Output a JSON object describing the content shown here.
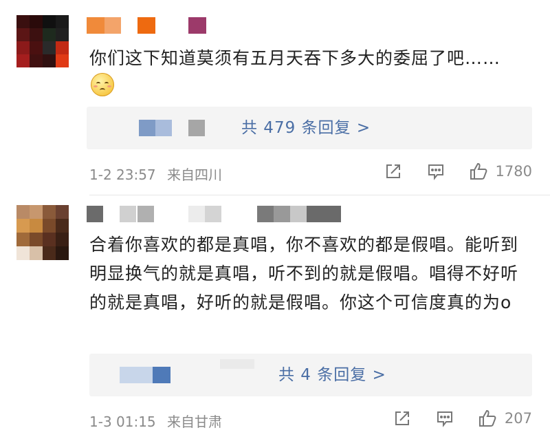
{
  "comments": [
    {
      "text": "你们这下知道莫须有五月天吞下多大的委屈了吧……",
      "emoji": "sad-blush-face",
      "replies_label": "共 479 条回复 >",
      "date": "1-2 23:57",
      "location": "来自四川",
      "likes": "1780"
    },
    {
      "text": "合着你喜欢的都是真唱，你不喜欢的都是假唱。能听到明显换气的就是真唱，听不到的就是假唱。唱得不好听的就是真唱，好听的就是假唱。你这个可信度真的为o",
      "replies_label": "共 4 条回复 >",
      "date": "1-3 01:15",
      "location": "来自甘肃",
      "likes": "207"
    }
  ],
  "colors": {
    "text": "#222222",
    "meta": "#8a8a8a",
    "link": "#4a6ea5",
    "reply_bg": "#f4f4f4"
  },
  "icons": [
    "share-icon",
    "comment-icon",
    "like-icon"
  ]
}
